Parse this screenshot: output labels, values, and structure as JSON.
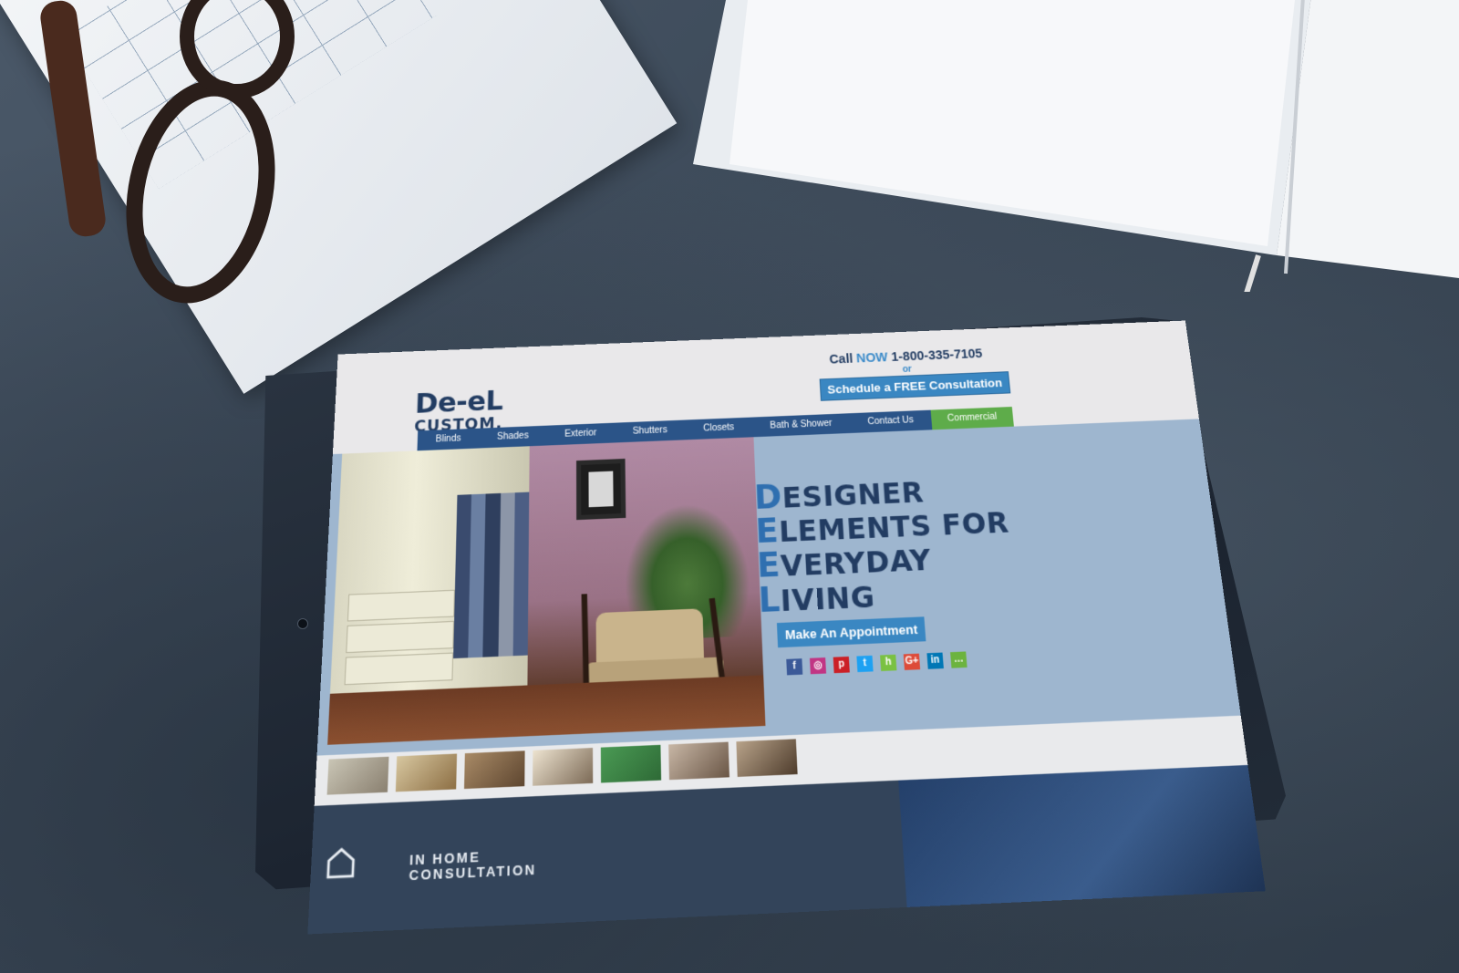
{
  "site": {
    "logo_line1": "De-eL",
    "logo_line2": "CUSTOM."
  },
  "header": {
    "call_prefix": "Call",
    "call_now": "NOW",
    "phone": "1-800-335-7105",
    "or": "or",
    "schedule_button": "Schedule a FREE Consultation"
  },
  "nav": {
    "items": [
      {
        "label": "Blinds"
      },
      {
        "label": "Shades"
      },
      {
        "label": "Exterior"
      },
      {
        "label": "Shutters"
      },
      {
        "label": "Closets"
      },
      {
        "label": "Bath & Shower"
      },
      {
        "label": "Contact Us"
      },
      {
        "label": "Commercial"
      }
    ]
  },
  "hero": {
    "lines": [
      {
        "cap": "D",
        "rest": "ESIGNER"
      },
      {
        "cap": "E",
        "rest": "LEMENTS FOR"
      },
      {
        "cap": "E",
        "rest": "VERYDAY"
      },
      {
        "cap": "L",
        "rest": "IVING"
      }
    ],
    "appointment_button": "Make An Appointment"
  },
  "social": [
    {
      "icon": "facebook-icon",
      "glyph": "f",
      "color": "#3b5998"
    },
    {
      "icon": "instagram-icon",
      "glyph": "◎",
      "color": "#c13584"
    },
    {
      "icon": "pinterest-icon",
      "glyph": "p",
      "color": "#cb2027"
    },
    {
      "icon": "twitter-icon",
      "glyph": "t",
      "color": "#1da1f2"
    },
    {
      "icon": "houzz-icon",
      "glyph": "h",
      "color": "#7ac142"
    },
    {
      "icon": "google-plus-icon",
      "glyph": "G+",
      "color": "#dd4b39"
    },
    {
      "icon": "linkedin-icon",
      "glyph": "in",
      "color": "#0077b5"
    },
    {
      "icon": "chat-icon",
      "glyph": "…",
      "color": "#6cb33f"
    }
  ],
  "lower": {
    "consultation": "IN HOME CONSULTATION"
  },
  "colors": {
    "brand_navy": "#223c62",
    "accent_blue": "#3a87c2",
    "nav_blue": "#2b5488",
    "commercial_green": "#5eac4a",
    "hero_bg": "#9eb6cf"
  }
}
